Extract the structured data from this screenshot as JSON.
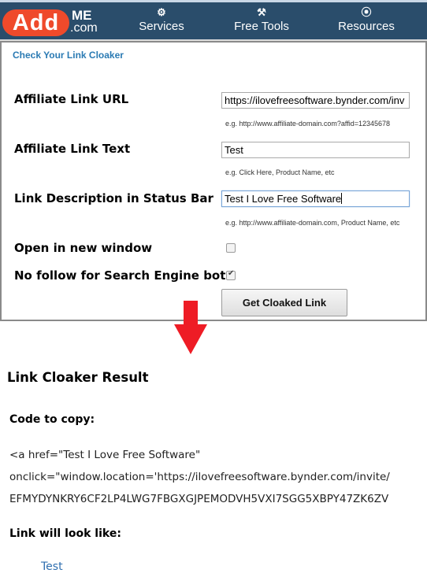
{
  "header": {
    "logo": {
      "add": "Add",
      "me": "ME",
      "com": ".com"
    },
    "nav": [
      {
        "label": "Services",
        "icon": "gear-icon",
        "glyph": "⚙"
      },
      {
        "label": "Free Tools",
        "icon": "tools-icon",
        "glyph": "⚒"
      },
      {
        "label": "Resources",
        "icon": "compass-icon",
        "glyph": "⦿"
      }
    ]
  },
  "form": {
    "title": "Check Your Link Cloaker",
    "fields": [
      {
        "label": "Affiliate Link URL",
        "value": "https://ilovefreesoftware.bynder.com/inv",
        "hint": "e.g. http://www.affiliate-domain.com?affid=12345678"
      },
      {
        "label": "Affiliate Link Text",
        "value": "Test",
        "hint": "e.g. Click Here, Product Name, etc"
      },
      {
        "label": "Link Description in Status Bar",
        "value": "Test I Love Free Software",
        "hint": "e.g. http://www.affiliate-domain.com, Product Name, etc"
      }
    ],
    "options": [
      {
        "label": "Open in new window",
        "checked": false
      },
      {
        "label": "No follow for Search Engine bots",
        "checked": true
      }
    ],
    "submit_label": "Get Cloaked Link"
  },
  "arrow_color": "#ee1c25",
  "result": {
    "title": "Link Cloaker Result",
    "code_label": "Code to copy:",
    "code_lines": [
      "<a href=\"Test I Love Free Software\"",
      "onclick=\"window.location='https://ilovefreesoftware.bynder.com/invite/",
      "EFMYDYNKRY6CF2LP4LWG7FBGXGJPEMODVH5VXI7SGG5XBPY47ZK6ZV"
    ],
    "preview_label": "Link will look like:",
    "preview_link": "Test"
  }
}
